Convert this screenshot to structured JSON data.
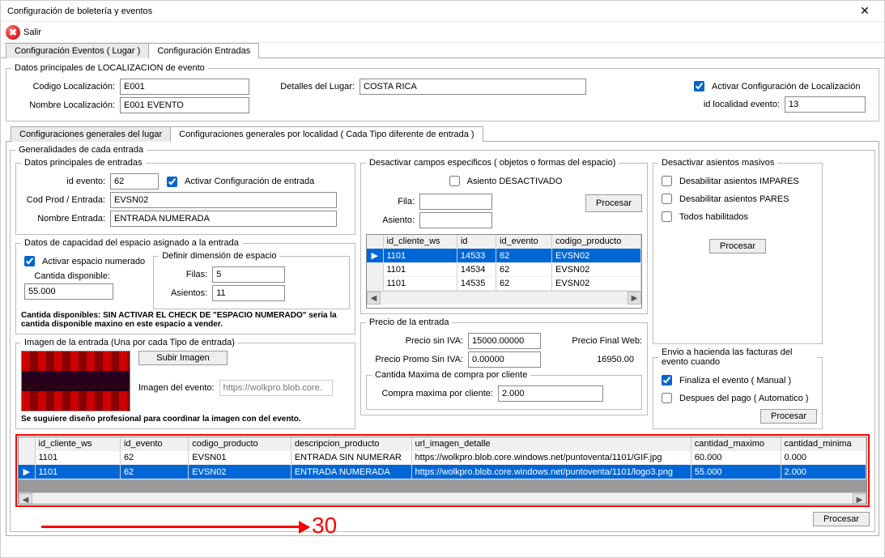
{
  "window": {
    "title": "Configuración de boletería y eventos"
  },
  "toolbar": {
    "salir": "Salir",
    "salir_glyph": "✖"
  },
  "mainTabs": {
    "lugar": "Configuración Eventos ( Lugar )",
    "entradas": "Configuración Entradas"
  },
  "loc": {
    "legend": "Datos principales de LOCALIZACION de evento",
    "codigo_lbl": "Codigo Localización:",
    "codigo_val": "E001",
    "nombre_lbl": "Nombre Localización:",
    "nombre_val": "E001 EVENTO",
    "detalles_lbl": "Detalles del Lugar:",
    "detalles_val": "COSTA RICA",
    "activar_chk": "Activar Configuración de Localización",
    "idloc_lbl": "id localidad evento:",
    "idloc_val": "13"
  },
  "subTabs": {
    "general": "Configuraciones generales del lugar",
    "porLocalidad": "Configuraciones generales por localidad ( Cada Tipo diferente de entrada )"
  },
  "entrada": {
    "legend": "Generalidades de cada entrada",
    "datos_legend": "Datos principales de entradas",
    "id_lbl": "id evento:",
    "id_val": "62",
    "activar": "Activar Configuración de entrada",
    "cod_lbl": "Cod Prod / Entrada:",
    "cod_val": "EVSN02",
    "nombre_lbl": "Nombre Entrada:",
    "nombre_val": "ENTRADA NUMERADA",
    "cap_legend": "Datos de capacidad del espacio asignado a la entrada",
    "chk_numerado": "Activar espacio numerado",
    "dim_legend": "Definir dimensión de espacio",
    "filas_lbl": "Filas:",
    "filas_val": "5",
    "asientos_lbl": "Asientos:",
    "asientos_val": "11",
    "cant_lbl": "Cantida disponible:",
    "cant_val": "55.000",
    "note": "Cantida disponibles: SIN ACTIVAR EL CHECK DE \"ESPACIO NUMERADO\" seria la cantida disponible maxino en este espacio  a vender."
  },
  "imagen": {
    "legend": "Imagen de la entrada (Una por cada Tipo de entrada)",
    "subir_btn": "Subir Imagen",
    "imgdel_lbl": "Imagen del evento:",
    "url_placeholder": "https://wolkpro.blob.core.",
    "note": "Se suguiere diseño profesional para coordinar la imagen con del evento."
  },
  "desactivar": {
    "legend": "Desactivar campos especificos ( objetos o formas del espacio)",
    "asiento_chk": "Asiento DESACTIVADO",
    "fila_lbl": "Fila:",
    "asiento_lbl": "Asiento:",
    "procesar": "Procesar",
    "cols": [
      "id_cliente_ws",
      "id",
      "id_evento",
      "codigo_producto"
    ],
    "rows": [
      [
        "1101",
        "14533",
        "62",
        "EVSN02"
      ],
      [
        "1101",
        "14534",
        "62",
        "EVSN02"
      ],
      [
        "1101",
        "14535",
        "62",
        "EVSN02"
      ]
    ]
  },
  "precio": {
    "legend": "Precio de la entrada",
    "siniva_lbl": "Precio sin IVA:",
    "siniva_val": "15000.00000",
    "promo_lbl": "Precio Promo Sin IVA:",
    "promo_val": "0.00000",
    "final_lbl": "Precio Final Web:",
    "final_val": "16950.00",
    "max_legend": "Cantida Maxima de compra por cliente",
    "max_lbl": "Compra maxima por cliente:",
    "max_val": "2.000"
  },
  "masivo": {
    "legend": "Desactivar asientos masivos",
    "impares": "Desabilitar asientos IMPARES",
    "pares": "Desabilitar asientos PARES",
    "todos": "Todos habilitados",
    "procesar": "Procesar"
  },
  "hacienda": {
    "legend": "Envio a hacienda las facturas del evento cuando",
    "manual": "Finaliza el evento ( Manual )",
    "auto": "Despues del pago ( Automatico )",
    "procesar": "Procesar"
  },
  "bigtable": {
    "cols": [
      "id_cliente_ws",
      "id_evento",
      "codigo_producto",
      "descripcion_producto",
      "url_imagen_detalle",
      "cantidad_maximo",
      "cantidad_minima"
    ],
    "rows": [
      [
        "1101",
        "62",
        "EVSN01",
        "ENTRADA SIN NUMERAR",
        "https://wolkpro.blob.core.windows.net/puntoventa/1101/GIF.jpg",
        "60.000",
        "0.000"
      ],
      [
        "1101",
        "62",
        "EVSN02",
        "ENTRADA NUMERADA",
        "https://wolkpro.blob.core.windows.net/puntoventa/1101/logo3.png",
        "55.000",
        "2.000"
      ]
    ],
    "selected": 1
  },
  "footer": {
    "procesar": "Procesar"
  },
  "annotation": "30"
}
